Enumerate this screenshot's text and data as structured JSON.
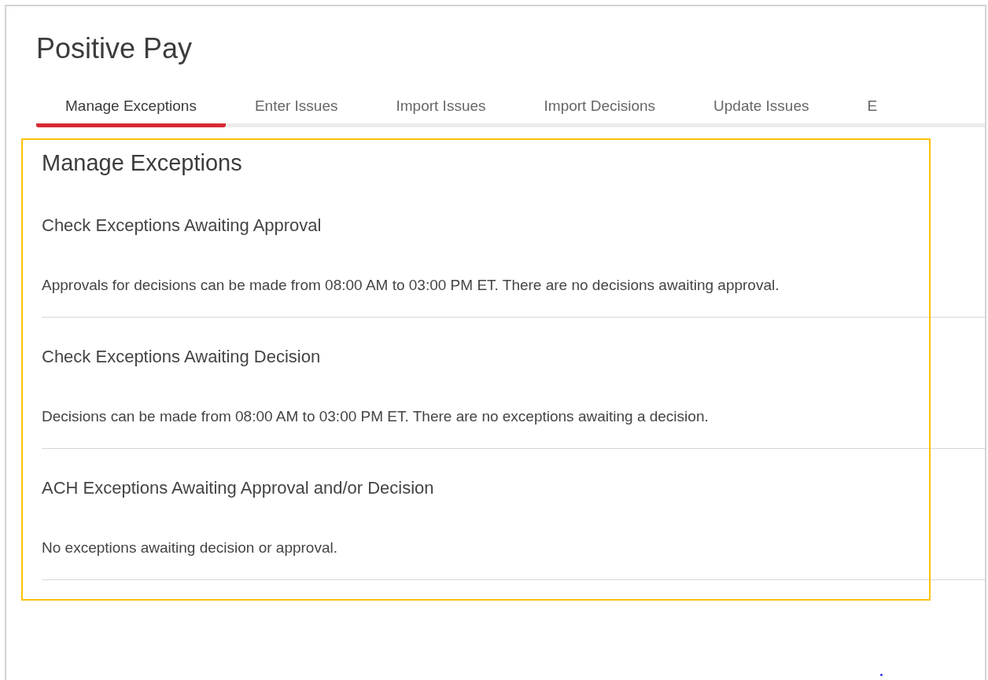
{
  "page": {
    "title": "Positive Pay"
  },
  "tabs": [
    {
      "label": "Manage Exceptions",
      "selected": true
    },
    {
      "label": "Enter Issues",
      "selected": false
    },
    {
      "label": "Import Issues",
      "selected": false
    },
    {
      "label": "Import Decisions",
      "selected": false
    },
    {
      "label": "Update Issues",
      "selected": false
    },
    {
      "label": "E",
      "selected": false
    }
  ],
  "content": {
    "heading": "Manage Exceptions",
    "sections": [
      {
        "title": "Check Exceptions Awaiting Approval",
        "message": "Approvals for decisions can be made from 08:00 AM to 03:00 PM ET. There are no decisions awaiting approval."
      },
      {
        "title": "Check Exceptions Awaiting Decision",
        "message": "Decisions can be made from 08:00 AM to 03:00 PM ET. There are no exceptions awaiting a decision."
      },
      {
        "title": "ACH Exceptions Awaiting Approval and/or Decision",
        "message": "No exceptions awaiting decision or approval."
      }
    ]
  }
}
